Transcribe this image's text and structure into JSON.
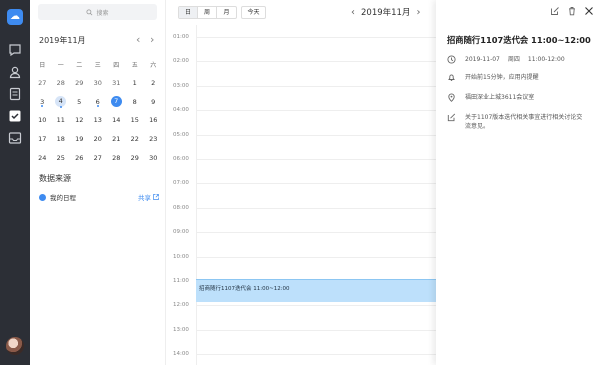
{
  "search": {
    "placeholder": "搜索"
  },
  "mini_calendar": {
    "title": "2019年11月",
    "weekdays": [
      "日",
      "一",
      "二",
      "三",
      "四",
      "五",
      "六"
    ],
    "weeks": [
      [
        "27",
        "28",
        "29",
        "30",
        "31",
        "1",
        "2"
      ],
      [
        "3",
        "4",
        "5",
        "6",
        "7",
        "8",
        "9"
      ],
      [
        "10",
        "11",
        "12",
        "13",
        "14",
        "15",
        "16"
      ],
      [
        "17",
        "18",
        "19",
        "20",
        "21",
        "22",
        "23"
      ],
      [
        "24",
        "25",
        "26",
        "27",
        "28",
        "29",
        "30"
      ]
    ],
    "today": "7",
    "selected": "4"
  },
  "data_source": {
    "title": "数据来源",
    "item_label": "我的日程",
    "share_label": "共享",
    "color": "#3e8bf0"
  },
  "toolbar": {
    "views": [
      "日",
      "周",
      "月"
    ],
    "active_view": "日",
    "today_label": "今天",
    "period": "2019年11月"
  },
  "day_view": {
    "hours": [
      "01:00",
      "02:00",
      "03:00",
      "04:00",
      "05:00",
      "06:00",
      "07:00",
      "08:00",
      "09:00",
      "10:00",
      "11:00",
      "12:00",
      "13:00",
      "14:00"
    ],
    "event_text": "招商随行1107迭代会 11:00~12:00",
    "event_color": "#bde0fb"
  },
  "detail": {
    "title": "招商随行1107迭代会 11:00~12:00",
    "date": "2019-11-07",
    "weekday": "周四",
    "time": "11:00-12:00",
    "reminder": "开始前15分钟，应用内提醒",
    "location": "福田深业上城3611会议室",
    "note": "关于1107版本迭代相关事宜进行相关讨论交流意见。"
  },
  "icons": {
    "logo": "cloud-logo-icon",
    "nav": [
      "chat-icon",
      "contacts-icon",
      "notes-icon",
      "calendar-check-icon",
      "inbox-icon"
    ]
  },
  "accent": "#3e8bf0"
}
